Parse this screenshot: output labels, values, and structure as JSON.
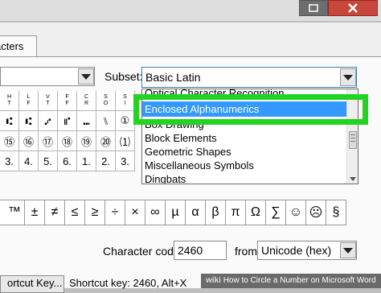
{
  "window": {
    "tab_label": "acters"
  },
  "subset": {
    "label": "Subset:",
    "value": "Basic Latin",
    "options": [
      "Optical Character Recognition",
      "Enclosed Alphanumerics",
      "Box Drawing",
      "Block Elements",
      "Geometric Shapes",
      "Miscellaneous Symbols",
      "Dingbats"
    ],
    "selected_index": 1
  },
  "grid_rows": [
    [
      "Ŀ",
      "↲",
      "⊥",
      "⊦",
      "⊥",
      "⊢",
      "⊥"
    ],
    [
      "⑆",
      "⑆",
      "⑇",
      "⑈",
      "⑉",
      "⑊",
      "①"
    ],
    [
      "⑮",
      "⑯",
      "⑰",
      "⑱",
      "⑲",
      "⑳",
      "⑴"
    ],
    [
      "3.",
      "4.",
      "5.",
      "6.",
      "1.",
      "2.",
      "3."
    ]
  ],
  "grid_row1_small": [
    "H\nT",
    "L\nF",
    "V\nT",
    "F\nF",
    "C\nR",
    "S\nO",
    "S\nI"
  ],
  "recent": [
    "™",
    "±",
    "≠",
    "≤",
    "≥",
    "÷",
    "×",
    "∞",
    "µ",
    "α",
    "β",
    "π",
    "Ω",
    "∑",
    "☺",
    "☹",
    "§"
  ],
  "character_code": {
    "label": "Character code:",
    "value": "2460"
  },
  "from": {
    "label": "from:",
    "value": "Unicode (hex)"
  },
  "shortcut": {
    "button_label": "ortcut Key...",
    "text": "Shortcut key: 2460, Alt+X"
  },
  "watermark": {
    "brand": "wiki",
    "text": "How to Circle a Number on Microsoft Word"
  },
  "colors": {
    "highlight_green": "#22d322",
    "selection_blue": "#3399ff",
    "close_red": "#c8463c"
  }
}
